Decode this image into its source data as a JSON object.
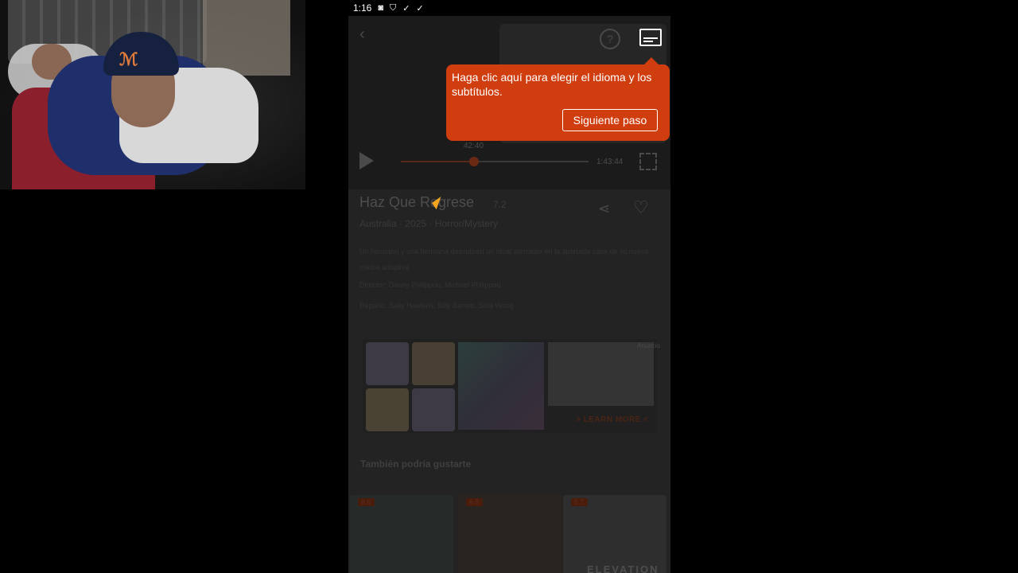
{
  "status_bar": {
    "time": "1:16",
    "icons": [
      "notification-a-icon",
      "shield-icon",
      "check-icon",
      "check-icon"
    ]
  },
  "player": {
    "current_time": "42:40",
    "duration": "1:43:44",
    "progress_fraction": 0.39,
    "icons": [
      "back-icon",
      "help-icon",
      "subtitles-icon",
      "play-icon",
      "fullscreen-icon"
    ]
  },
  "movie": {
    "title": "Haz Que Regrese",
    "rating": "7.2",
    "meta": "Australia · 2025 · Horror/Mystery",
    "description": "Un hermano y una hermana descubren un ritual aterrador en la apartada casa de su nueva madre adoptiva.",
    "credits_1": "Director: Danny Philippou, Michael Philippou",
    "credits_2": "Reparto: Sally Hawkins, Billy Barratt, Sora Wong"
  },
  "ad": {
    "sponsor_label": "Anuncio",
    "cta": "> LEARN MORE <"
  },
  "recommendations": {
    "heading": "También podría gustarte",
    "posters": [
      {
        "badge": "8.6"
      },
      {
        "badge": "6.5"
      },
      {
        "badge": "5.7",
        "title": "ELEVATION"
      }
    ]
  },
  "tooltip": {
    "text": "Haga clic aquí para elegir el idioma y los subtítulos.",
    "next_button": "Siguiente paso"
  },
  "colors": {
    "accent": "#d03e0f",
    "background": "#232323"
  }
}
